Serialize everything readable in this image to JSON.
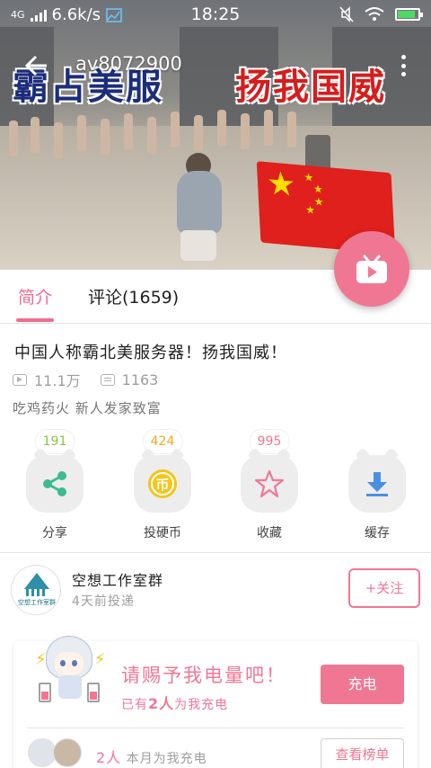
{
  "status_bar": {
    "network": "4G",
    "speed": "6.6k/s",
    "time": "18:25"
  },
  "video": {
    "av_id": "av8072900",
    "banner_text_left": "霸占美服",
    "banner_text_right": "扬我国威",
    "title": "中国人称霸北美服务器！扬我国威！",
    "views": "11.1万",
    "danmaku": "1163",
    "tags": "吃鸡药火 新人发家致富"
  },
  "tabs": [
    {
      "label": "简介",
      "active": true
    },
    {
      "label": "评论(1659)",
      "active": false
    }
  ],
  "actions": [
    {
      "label": "分享",
      "count": "191",
      "count_color": "#8bc34a",
      "icon": "share-icon"
    },
    {
      "label": "投硬币",
      "count": "424",
      "count_color": "#f5a623",
      "icon": "coin-icon"
    },
    {
      "label": "收藏",
      "count": "995",
      "count_color": "#f07793",
      "icon": "star-icon"
    },
    {
      "label": "缓存",
      "count": "",
      "count_color": "",
      "icon": "download-icon"
    }
  ],
  "uploader": {
    "name": "空想工作室群",
    "post_time": "4天前投递",
    "follow_label": "+关注",
    "avatar_text": "空想工作室群"
  },
  "charge": {
    "title": "请赐予我电量吧！",
    "sub_prefix": "已有",
    "sub_count": "2人",
    "sub_suffix": "为我充电",
    "button_label": "充电",
    "monthly_count": "2人",
    "monthly_suffix": "本月为我充电",
    "rank_label": "查看榜单"
  },
  "colors": {
    "accent": "#f07793",
    "share": "#3dbb8f",
    "coin": "#f5a623",
    "download": "#4a90e2"
  }
}
